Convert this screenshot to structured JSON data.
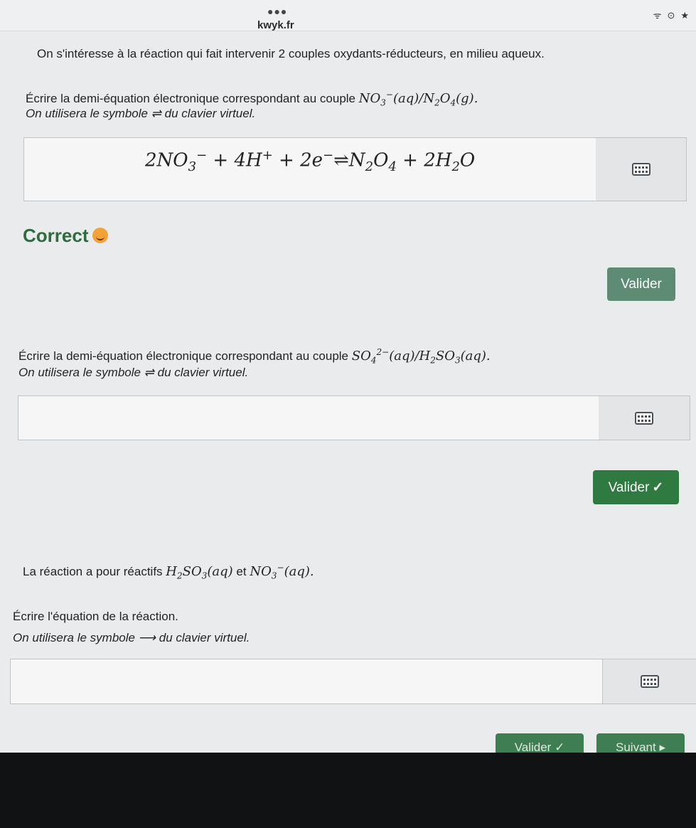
{
  "browser": {
    "url": "kwyk.fr",
    "status_icons": [
      "wifi-icon",
      "record-icon",
      "star-icon"
    ]
  },
  "intro": "On s'intéresse à la réaction qui fait intervenir 2 couples oxydants-réducteurs, en milieu aqueux.",
  "q1": {
    "prompt": "Écrire la demi-équation électronique correspondant au couple",
    "couple_parts": [
      "NO",
      "3",
      "−",
      "(aq)/N",
      "2",
      "O",
      "4",
      "(g)."
    ],
    "hint": "On utilisera le symbole ⇌ du clavier virtuel.",
    "answer": {
      "parts": [
        "2NO",
        "3",
        "−",
        " + 4H",
        "+",
        " + 2e",
        "−",
        "⇌N",
        "2",
        "O",
        "4",
        " + 2H",
        "2",
        "O"
      ]
    },
    "feedback": "Correct",
    "submit_label": "Valider"
  },
  "q2": {
    "prompt": "Écrire la demi-équation électronique correspondant au couple",
    "couple_parts": [
      "SO",
      "4",
      "2−",
      "(aq)/H",
      "2",
      "SO",
      "3",
      "(aq)."
    ],
    "hint": "On utilisera le symbole ⇌ du clavier virtuel.",
    "answer_value": "",
    "submit_label": "Valider",
    "submit_check": "✓"
  },
  "q3": {
    "reactants_prefix": "La réaction a pour réactifs",
    "reactant1_parts": [
      "H",
      "2",
      "SO",
      "3",
      "(aq)"
    ],
    "connector": "et",
    "reactant2_parts": [
      "NO",
      "3",
      "−",
      "(aq)."
    ],
    "prompt": "Écrire l'équation de la réaction.",
    "hint": "On utilisera le symbole ⟶ du clavier virtuel.",
    "answer_value": "",
    "bottom_buttons": [
      "Valider ✓",
      "Suivant ▸"
    ]
  },
  "colors": {
    "accent_green": "#2f7a41",
    "correct_text": "#2e6b3e",
    "page_bg": "#e9ebec"
  }
}
